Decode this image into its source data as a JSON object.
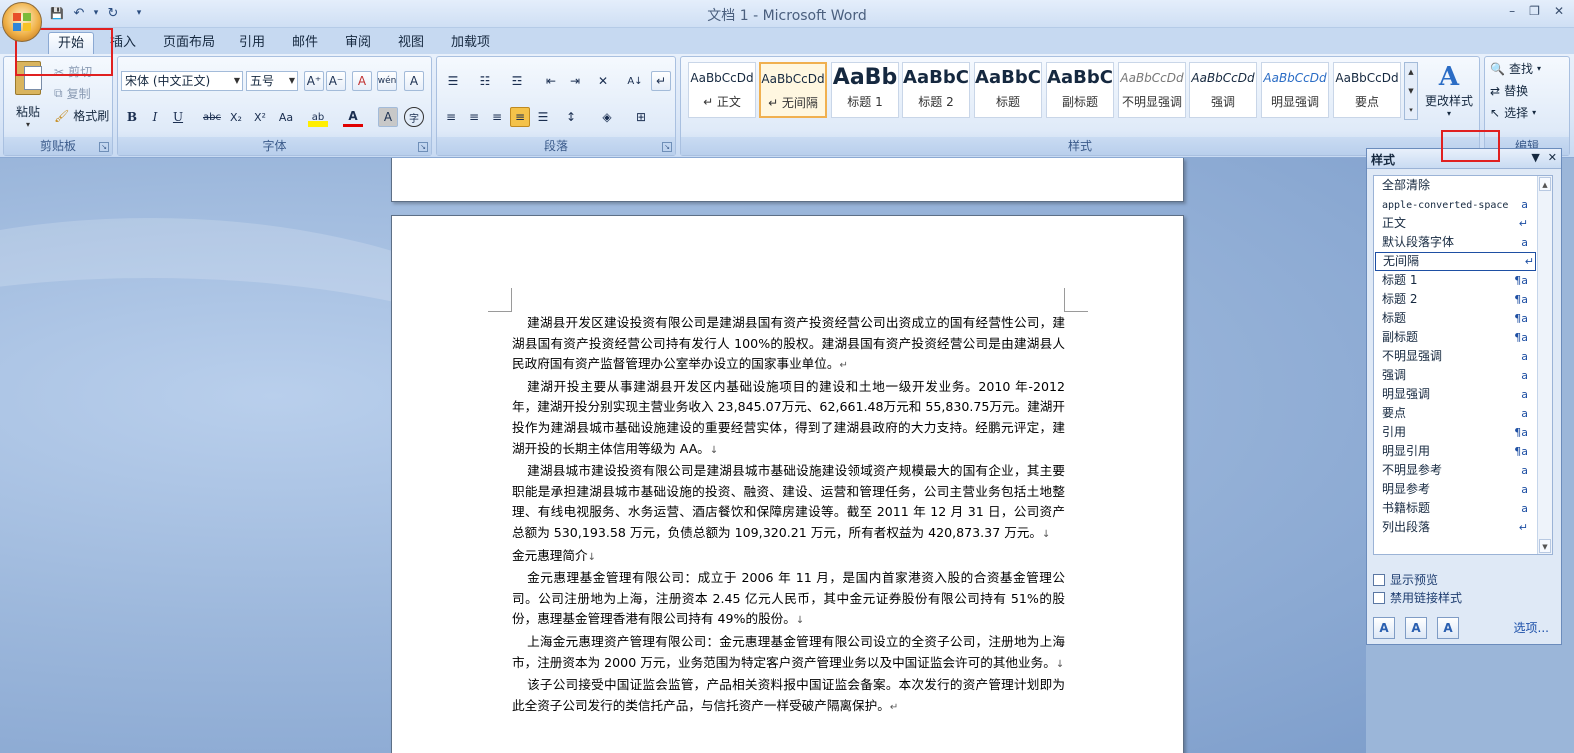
{
  "window": {
    "title": "文档 1 - Microsoft Word",
    "controls": [
      "–",
      "❐",
      "✕"
    ]
  },
  "qat": {
    "save": "💾",
    "undo": "↶",
    "undo_drop": "▾",
    "redo": "↻",
    "customize": "▾"
  },
  "tabs": [
    "开始",
    "插入",
    "页面布局",
    "引用",
    "邮件",
    "审阅",
    "视图",
    "加载项"
  ],
  "ribbon": {
    "clipboard": {
      "label": "剪贴板",
      "paste": "粘贴",
      "cut": "剪切",
      "copy": "复制",
      "format_painter": "格式刷"
    },
    "font": {
      "label": "字体",
      "font_name": "宋体 (中文正文)",
      "font_size": "五号",
      "bold": "B",
      "italic": "I",
      "underline": "U",
      "strike": "abc",
      "subscript": "X₂",
      "superscript": "X²",
      "case": "Aa",
      "grow": "A⁺",
      "shrink": "A⁻",
      "clear": "A",
      "phonetic": "wén",
      "border": "A",
      "highlight": "ab",
      "font_color": "A",
      "shade": "A",
      "enclose": "字"
    },
    "paragraph": {
      "label": "段落"
    },
    "styles": {
      "label": "样式",
      "gallery": [
        {
          "sample": "AaBbCcDd",
          "name": "↵ 正文"
        },
        {
          "sample": "AaBbCcDd",
          "name": "↵ 无间隔"
        },
        {
          "sample": "AaBb",
          "name": "标题 1"
        },
        {
          "sample": "AaBbC",
          "name": "标题 2"
        },
        {
          "sample": "AaBbC",
          "name": "标题"
        },
        {
          "sample": "AaBbC",
          "name": "副标题"
        },
        {
          "sample": "AaBbCcDd",
          "name": "不明显强调"
        },
        {
          "sample": "AaBbCcDd",
          "name": "强调"
        },
        {
          "sample": "AaBbCcDd",
          "name": "明显强调"
        },
        {
          "sample": "AaBbCcDd",
          "name": "要点"
        }
      ],
      "change_styles": "更改样式"
    },
    "editing": {
      "label": "编辑",
      "find": "查找",
      "replace": "替换",
      "select": "选择"
    }
  },
  "document": {
    "paragraphs": [
      "建湖县开发区建设投资有限公司是建湖县国有资产投资经营公司出资成立的国有经营性公司，建湖县国有资产投资经营公司持有发行人 100%的股权。建湖县国有资产投资经营公司是由建湖县人民政府国有资产监督管理办公室举办设立的国家事业单位。",
      "建湖开投主要从事建湖县开发区内基础设施项目的建设和土地一级开发业务。2010 年-2012年，建湖开投分别实现主营业务收入 23,845.07万元、62,661.48万元和 55,830.75万元。建湖开投作为建湖县城市基础设施建设的重要经营实体，得到了建湖县政府的大力支持。经鹏元评定，建湖开投的长期主体信用等级为 AA。",
      "建湖县城市建设投资有限公司是建湖县城市基础设施建设领域资产规模最大的国有企业，其主要职能是承担建湖县城市基础设施的投资、融资、建设、运营和管理任务，公司主营业务包括土地整理、有线电视服务、水务运营、酒店餐饮和保障房建设等。截至 2011 年 12 月 31 日，公司资产总额为 530,193.58 万元，负债总额为 109,320.21 万元，所有者权益为 420,873.37 万元。",
      "金元惠理简介",
      "金元惠理基金管理有限公司：成立于 2006 年 11 月，是国内首家港资入股的合资基金管理公司。公司注册地为上海，注册资本 2.45 亿元人民币，其中金元证券股份有限公司持有 51%的股份，惠理基金管理香港有限公司持有 49%的股份。",
      "上海金元惠理资产管理有限公司：金元惠理基金管理有限公司设立的全资子公司，注册地为上海市，注册资本为 2000 万元，业务范围为特定客户资产管理业务以及中国证监会许可的其他业务。",
      "该子公司接受中国证监会监管，产品相关资料报中国证监会备案。本次发行的资产管理计划即为此全资子公司发行的类信托产品，与信托资产一样受破产隔离保护。"
    ],
    "para_mark": "↵",
    "line_mark": "↓"
  },
  "styles_pane": {
    "title": "样式",
    "items": [
      {
        "name": "全部清除",
        "mark": ""
      },
      {
        "name": "apple-converted-space",
        "mark": "a"
      },
      {
        "name": "正文",
        "mark": "↵"
      },
      {
        "name": "默认段落字体",
        "mark": "a"
      },
      {
        "name": "无间隔",
        "mark": "↵"
      },
      {
        "name": "标题 1",
        "mark": "¶a"
      },
      {
        "name": "标题 2",
        "mark": "¶a"
      },
      {
        "name": "标题",
        "mark": "¶a"
      },
      {
        "name": "副标题",
        "mark": "¶a"
      },
      {
        "name": "不明显强调",
        "mark": "a"
      },
      {
        "name": "强调",
        "mark": "a"
      },
      {
        "name": "明显强调",
        "mark": "a"
      },
      {
        "name": "要点",
        "mark": "a"
      },
      {
        "name": "引用",
        "mark": "¶a"
      },
      {
        "name": "明显引用",
        "mark": "¶a"
      },
      {
        "name": "不明显参考",
        "mark": "a"
      },
      {
        "name": "明显参考",
        "mark": "a"
      },
      {
        "name": "书籍标题",
        "mark": "a"
      },
      {
        "name": "列出段落",
        "mark": "↵"
      }
    ],
    "show_preview": "显示预览",
    "disable_linked": "禁用链接样式",
    "options": "选项..."
  },
  "colors": {
    "highlight_border": "#e02020",
    "accent": "#1e4fa3"
  }
}
